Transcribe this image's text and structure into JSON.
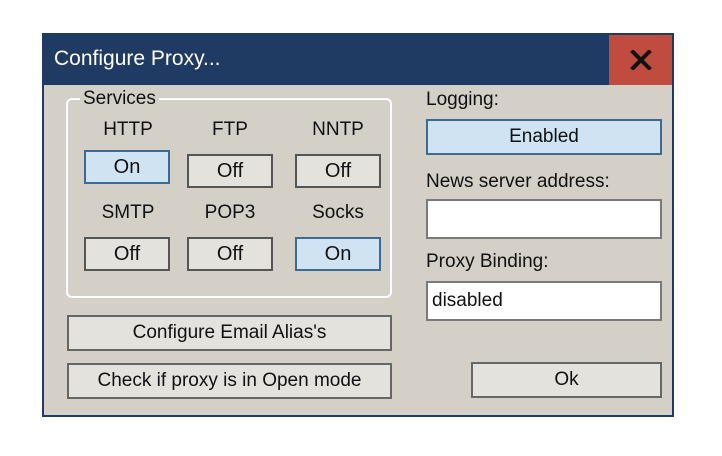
{
  "window": {
    "title": "Configure Proxy..."
  },
  "titlebar": {
    "close_label": "x"
  },
  "services": {
    "legend": "Services",
    "items": [
      {
        "name": "HTTP",
        "state": "On"
      },
      {
        "name": "FTP",
        "state": "Off"
      },
      {
        "name": "NNTP",
        "state": "Off"
      },
      {
        "name": "SMTP",
        "state": "Off"
      },
      {
        "name": "POP3",
        "state": "Off"
      },
      {
        "name": "Socks",
        "state": "On"
      }
    ]
  },
  "logging": {
    "label": "Logging:",
    "value": "Enabled"
  },
  "news_server": {
    "label": "News server address:",
    "value": ""
  },
  "proxy_binding": {
    "label": "Proxy Binding:",
    "value": "disabled"
  },
  "buttons": {
    "email_alias": "Configure Email Alias's",
    "open_mode": "Check if proxy is in Open mode",
    "ok": "Ok"
  },
  "colors": {
    "titlebar": "#1f3a63",
    "close_button": "#c04b3f",
    "dialog_face": "#d4d0c8",
    "toggle_on": "#cfe3f3"
  }
}
